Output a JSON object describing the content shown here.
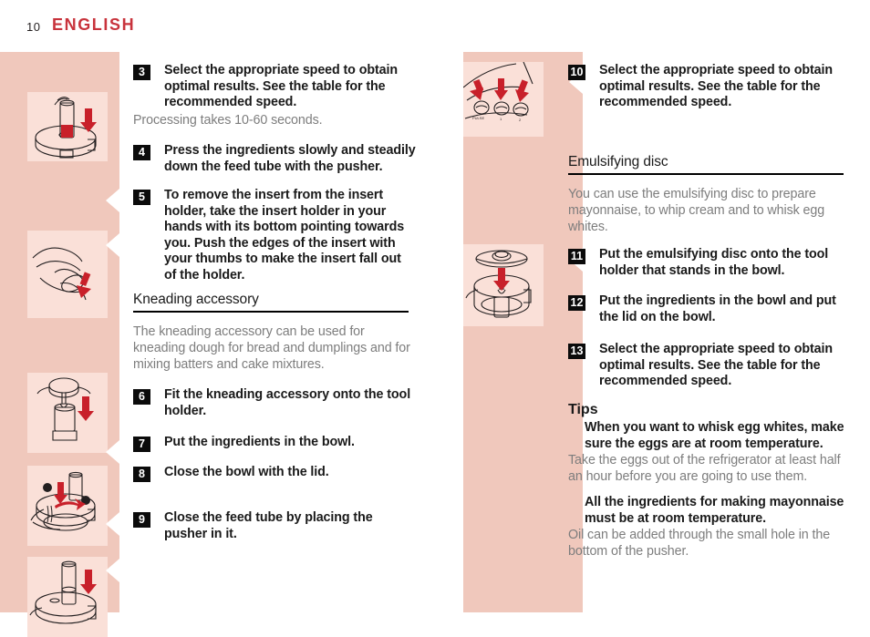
{
  "header": {
    "page_number": "10",
    "title": "ENGLISH",
    "title_color": "#c8333c"
  },
  "colors": {
    "band": "#f0c8bc",
    "tile": "#fae0d8",
    "arrow_red": "#c8202a",
    "badge_bg": "#0b0b0b",
    "note_text": "#7d7d7d",
    "body_text": "#1a1a1a"
  },
  "left_column": {
    "steps": [
      {
        "number": "3",
        "text": "Select the appropriate speed to obtain optimal results. See the table for the recommended speed."
      },
      {
        "number": "4",
        "text": "Press the ingredients slowly and steadily down the feed tube with the pusher."
      },
      {
        "number": "5",
        "text": "To remove the insert from the insert holder, take the insert holder in your hands with its bottom pointing towards you. Push the edges of the insert with your thumbs to make the insert fall out of the holder."
      },
      {
        "number": "6",
        "text": "Fit the kneading accessory onto the tool holder."
      },
      {
        "number": "7",
        "text": "Put the ingredients in the bowl."
      },
      {
        "number": "8",
        "text": "Close the bowl with the lid."
      },
      {
        "number": "9",
        "text": "Close the feed tube by placing the pusher in it."
      }
    ],
    "note_processing": "Processing takes 10-60 seconds.",
    "section_kneading": "Kneading accessory",
    "intro_kneading": "The kneading accessory can be used for kneading dough for bread and dumplings and for mixing batters and cake mixtures.",
    "illustrations": [
      {
        "name": "pusher-down-feed-tube-illustration"
      },
      {
        "name": "insert-holder-in-hands-illustration"
      },
      {
        "name": "kneading-accessory-on-tool-holder-illustration"
      },
      {
        "name": "kneading-accessory-in-bowl-illustration"
      },
      {
        "name": "pusher-in-feed-tube-illustration"
      }
    ]
  },
  "right_column": {
    "steps": [
      {
        "number": "10",
        "text": "Select the appropriate speed to obtain optimal results. See the table for the recommended speed."
      },
      {
        "number": "11",
        "text": "Put the emulsifying disc onto the tool holder that stands in the bowl."
      },
      {
        "number": "12",
        "text": "Put the ingredients in the bowl and put the lid on the bowl."
      },
      {
        "number": "13",
        "text": "Select the appropriate speed to obtain optimal results. See the table for the recommended speed."
      }
    ],
    "section_emulsifying": "Emulsifying disc",
    "intro_emulsifying": "You can use the emulsifying disc to prepare mayonnaise, to whip cream and to whisk egg whites.",
    "tips_heading": "Tips",
    "tip_1": "When you want to whisk egg whites, make sure the eggs are at room temperature.",
    "tip_1_note": "Take the eggs out of the refrigerator at least half an hour before you are going to use them.",
    "tip_2": "All the ingredients for making mayonnaise must be at room temperature.",
    "tip_2_note": "Oil can be added through the small hole in the bottom of the pusher.",
    "illustrations": [
      {
        "name": "control-panel-buttons-illustration"
      },
      {
        "name": "emulsifying-disc-onto-tool-holder-illustration"
      }
    ]
  }
}
